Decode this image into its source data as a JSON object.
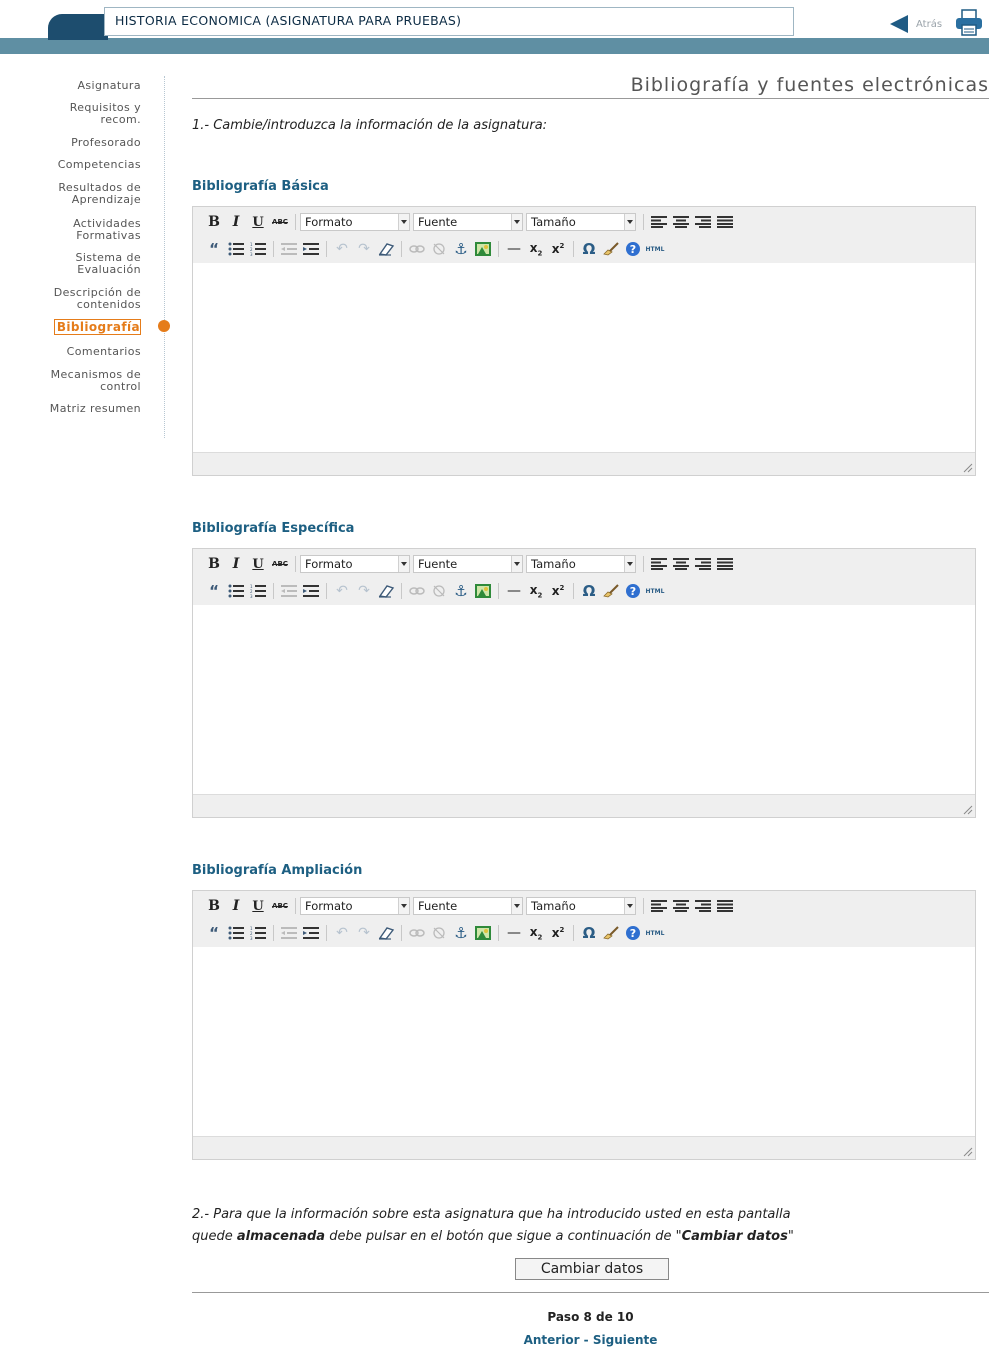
{
  "header": {
    "title": "HISTORIA ECONOMICA (ASIGNATURA PARA PRUEBAS)",
    "back_label": "Atrás"
  },
  "sidebar": {
    "items": [
      {
        "label": "Asignatura"
      },
      {
        "label": "Requisitos y\nrecom."
      },
      {
        "label": "Profesorado"
      },
      {
        "label": "Competencias"
      },
      {
        "label": "Resultados de\nAprendizaje"
      },
      {
        "label": "Actividades\nFormativas"
      },
      {
        "label": "Sistema de\nEvaluación"
      },
      {
        "label": "Descripción de\ncontenidos"
      },
      {
        "label": "Bibliografía",
        "active": true
      },
      {
        "label": "Comentarios"
      },
      {
        "label": "Mecanismos de\ncontrol"
      },
      {
        "label": "Matriz resumen"
      }
    ],
    "active_color": "#e57c1a"
  },
  "main": {
    "page_title": "Bibliografía y fuentes electrónicas",
    "instruction1": "1.- Cambie/introduzca la información de la asignatura:",
    "sections": [
      {
        "heading": "Bibliografía Básica"
      },
      {
        "heading": "Bibliografía Específica"
      },
      {
        "heading": "Bibliografía Ampliación"
      }
    ],
    "toolbar": {
      "format_select": "Formato",
      "font_select": "Fuente",
      "size_select": "Tamaño",
      "html_label": "HTML"
    },
    "instruction2_line1": "2.- Para que la información sobre esta asignatura que ha introducido usted en esta pantalla",
    "instruction2_line2_a": "quede ",
    "instruction2_line2_b": "almacenada",
    "instruction2_line2_c": " debe pulsar en el botón que sigue a continuación de \"",
    "instruction2_line2_d": "Cambiar datos",
    "instruction2_line2_e": "\"",
    "submit_label": "Cambiar datos",
    "step_text": "Paso 8 de 10",
    "prev_label": "Anterior",
    "pager_sep": " - ",
    "next_label": "Siguiente"
  },
  "colors": {
    "header_band": "#5f8fa3",
    "header_tab": "#1d4d6e",
    "link": "#1d5f82",
    "accent": "#e57c1a"
  }
}
